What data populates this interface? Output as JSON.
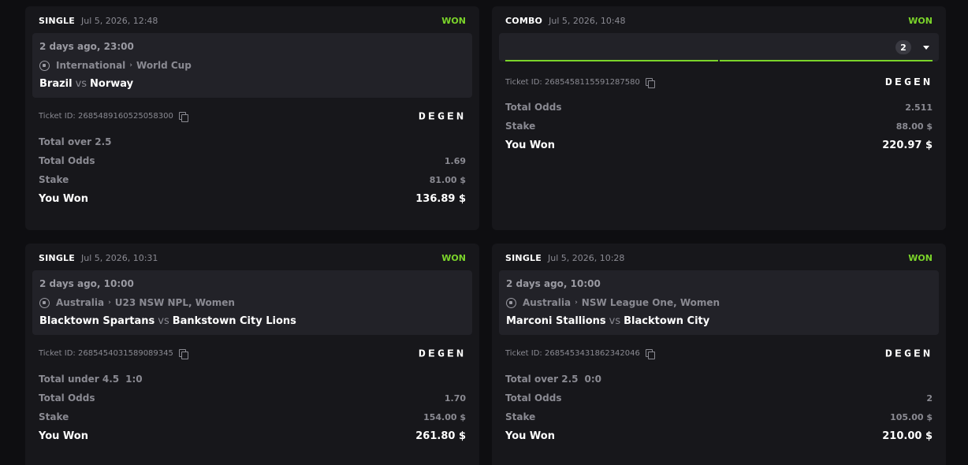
{
  "colors": {
    "won": "#7bd42a",
    "card": "#17171b",
    "inner": "#222228",
    "muted": "#8a8a92"
  },
  "brand": "DEGEN",
  "labels": {
    "vs": "vs",
    "ticket_prefix": "Ticket ID:",
    "total_odds": "Total Odds",
    "stake": "Stake",
    "you_won": "You Won"
  },
  "cards": [
    {
      "type": "SINGLE",
      "date": "Jul 5, 2026, 12:48",
      "status": "WON",
      "event_time": "2 days ago, 23:00",
      "country": "International",
      "league": "World Cup",
      "home": "Brazil",
      "away": "Norway",
      "ticket_id": "2685489160525058300",
      "market": "Total over 2.5",
      "score": "",
      "odds": "1.69",
      "stake": "81.00 $",
      "won": "136.89 $"
    },
    {
      "type": "COMBO",
      "date": "Jul 5, 2026, 10:48",
      "status": "WON",
      "selections": "2",
      "ticket_id": "2685458115591287580",
      "odds": "2.511",
      "stake": "88.00 $",
      "won": "220.97 $"
    },
    {
      "type": "SINGLE",
      "date": "Jul 5, 2026, 10:31",
      "status": "WON",
      "event_time": "2 days ago, 10:00",
      "country": "Australia",
      "league": "U23 NSW NPL, Women",
      "home": "Blacktown Spartans",
      "away": "Bankstown City Lions",
      "ticket_id": "2685454031589089345",
      "market": "Total under 4.5",
      "score": "1:0",
      "odds": "1.70",
      "stake": "154.00 $",
      "won": "261.80 $"
    },
    {
      "type": "SINGLE",
      "date": "Jul 5, 2026, 10:28",
      "status": "WON",
      "event_time": "2 days ago, 10:00",
      "country": "Australia",
      "league": "NSW League One, Women",
      "home": "Marconi Stallions",
      "away": "Blacktown City",
      "ticket_id": "2685453431862342046",
      "market": "Total over 2.5",
      "score": "0:0",
      "odds": "2",
      "stake": "105.00 $",
      "won": "210.00 $"
    }
  ]
}
